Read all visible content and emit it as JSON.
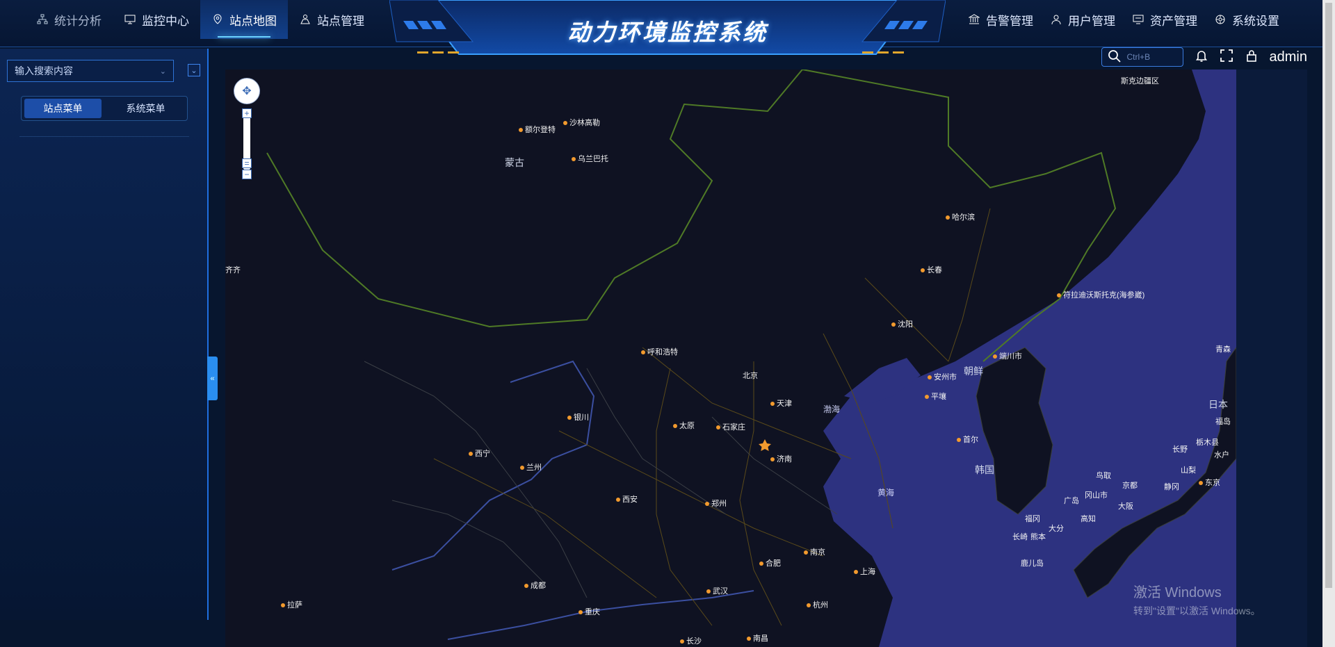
{
  "nav_left": [
    {
      "label": "统计分析",
      "icon": "org-chart-icon",
      "active": false
    },
    {
      "label": "监控中心",
      "icon": "monitor-icon",
      "active": false
    },
    {
      "label": "站点地图",
      "icon": "map-pin-icon",
      "active": true
    },
    {
      "label": "站点管理",
      "icon": "site-manage-icon",
      "active": false
    }
  ],
  "title": "动力环境监控系统",
  "nav_right": [
    {
      "label": "告警管理",
      "icon": "bank-icon"
    },
    {
      "label": "用户管理",
      "icon": "user-icon"
    },
    {
      "label": "资产管理",
      "icon": "computer-icon"
    },
    {
      "label": "系统设置",
      "icon": "gear-icon"
    }
  ],
  "toolbar": {
    "search_placeholder": "Ctrl+B",
    "user": "admin"
  },
  "sidebar": {
    "search_placeholder": "输入搜索内容",
    "tabs": [
      {
        "label": "站点菜单",
        "active": true
      },
      {
        "label": "系统菜单",
        "active": false
      }
    ],
    "collapse_label": "«"
  },
  "map": {
    "regions": [
      {
        "name": "蒙古"
      },
      {
        "name": "朝鲜"
      },
      {
        "name": "韩国"
      },
      {
        "name": "日本"
      }
    ],
    "seas": [
      {
        "name": "渤海"
      },
      {
        "name": "黄海"
      }
    ],
    "cities": [
      {
        "name": "额尔登特"
      },
      {
        "name": "沙林高勒"
      },
      {
        "name": "乌兰巴托"
      },
      {
        "name": "哈尔滨"
      },
      {
        "name": "长春"
      },
      {
        "name": "沈阳"
      },
      {
        "name": "呼和浩特"
      },
      {
        "name": "北京"
      },
      {
        "name": "天津"
      },
      {
        "name": "银川"
      },
      {
        "name": "太原"
      },
      {
        "name": "石家庄"
      },
      {
        "name": "西宁"
      },
      {
        "name": "兰州"
      },
      {
        "name": "济南"
      },
      {
        "name": "西安"
      },
      {
        "name": "郑州"
      },
      {
        "name": "合肥"
      },
      {
        "name": "南京"
      },
      {
        "name": "上海"
      },
      {
        "name": "成都"
      },
      {
        "name": "武汉"
      },
      {
        "name": "杭州"
      },
      {
        "name": "重庆"
      },
      {
        "name": "长沙"
      },
      {
        "name": "南昌"
      },
      {
        "name": "拉萨"
      },
      {
        "name": "安州市"
      },
      {
        "name": "平壤"
      },
      {
        "name": "首尔"
      },
      {
        "name": "符拉迪沃斯托克(海参崴)"
      },
      {
        "name": "端川市"
      },
      {
        "name": "青森"
      },
      {
        "name": "福岛"
      },
      {
        "name": "栃木县"
      },
      {
        "name": "长野"
      },
      {
        "name": "水户"
      },
      {
        "name": "山梨"
      },
      {
        "name": "静冈"
      },
      {
        "name": "东京"
      },
      {
        "name": "京都"
      },
      {
        "name": "大阪"
      },
      {
        "name": "冈山市"
      },
      {
        "name": "广岛"
      },
      {
        "name": "鸟取"
      },
      {
        "name": "福冈"
      },
      {
        "name": "大分"
      },
      {
        "name": "长崎"
      },
      {
        "name": "熊本"
      },
      {
        "name": "鹿儿岛"
      },
      {
        "name": "高知"
      },
      {
        "name": "齐齐"
      },
      {
        "name": "斯克边疆区"
      }
    ]
  },
  "watermark": {
    "line1": "激活 Windows",
    "line2": "转到\"设置\"以激活 Windows。"
  }
}
